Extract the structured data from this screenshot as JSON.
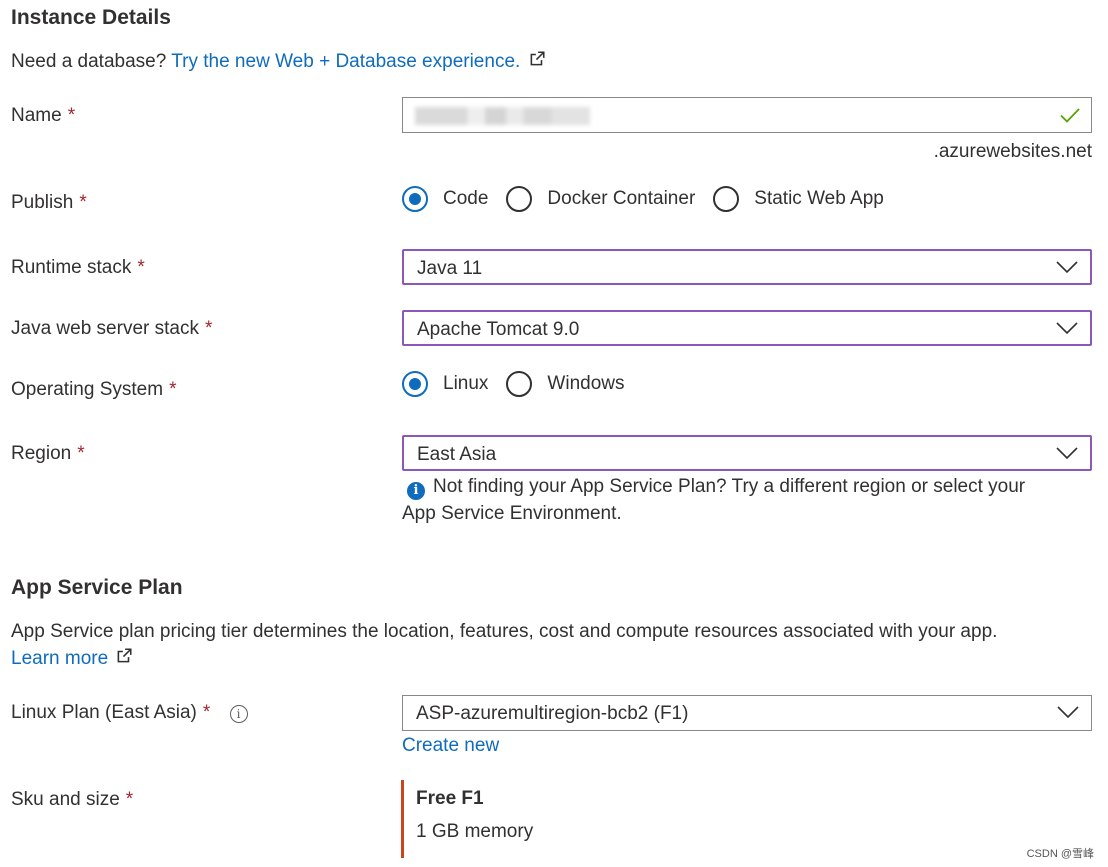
{
  "instance_details": {
    "title": "Instance Details",
    "db_prompt": "Need a database?",
    "db_link": "Try the new Web + Database experience."
  },
  "name_field": {
    "label": "Name",
    "required": "*",
    "suffix": ".azurewebsites.net"
  },
  "publish": {
    "label": "Publish",
    "required": "*",
    "options": [
      "Code",
      "Docker Container",
      "Static Web App"
    ],
    "selected": "Code"
  },
  "runtime_stack": {
    "label": "Runtime stack",
    "required": "*",
    "value": "Java 11"
  },
  "java_web_server": {
    "label": "Java web server stack",
    "required": "*",
    "value": "Apache Tomcat 9.0"
  },
  "operating_system": {
    "label": "Operating System",
    "required": "*",
    "options": [
      "Linux",
      "Windows"
    ],
    "selected": "Linux"
  },
  "region": {
    "label": "Region",
    "required": "*",
    "value": "East Asia",
    "info_line1": "Not finding your App Service Plan? Try a different region or select your",
    "info_line2": "App Service Environment."
  },
  "app_service_plan": {
    "title": "App Service Plan",
    "description": "App Service plan pricing tier determines the location, features, cost and compute resources associated with your app.",
    "learn_more": "Learn more"
  },
  "linux_plan": {
    "label": "Linux Plan (East Asia)",
    "required": "*",
    "value": "ASP-azuremultiregion-bcb2 (F1)",
    "create_new": "Create new"
  },
  "sku": {
    "label": "Sku and size",
    "required": "*",
    "tier": "Free F1",
    "memory": "1 GB memory"
  },
  "watermark": "CSDN @雪峰",
  "colors": {
    "accent": "#0f6cbd",
    "focus_border": "#8a58b8",
    "required": "#a4262c",
    "valid": "#57a300",
    "sku_bar": "#c8461e"
  }
}
